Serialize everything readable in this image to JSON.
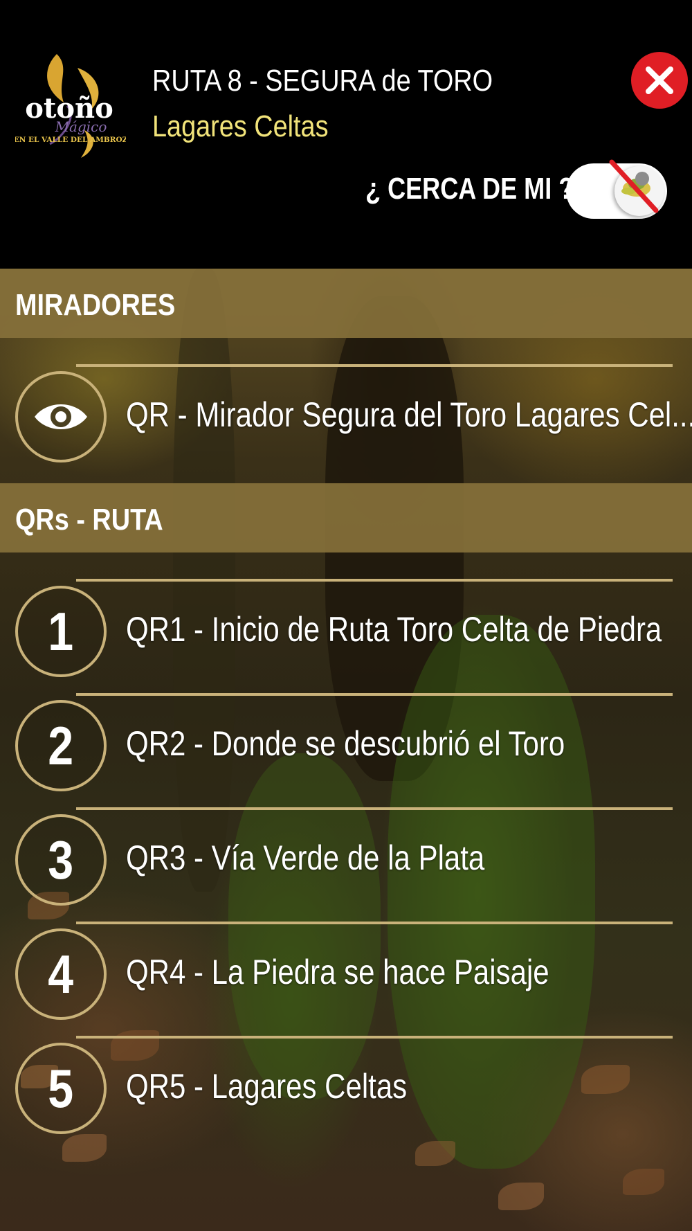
{
  "header": {
    "logo": {
      "word": "otoño",
      "script": "Mágico",
      "tagline": "EN EL VALLE DEL AMBROZ"
    },
    "title": "RUTA 8 - SEGURA de TORO",
    "subtitle": "Lagares Celtas",
    "close_icon": "close-icon",
    "near_label": "¿ CERCA DE MI ?",
    "near_toggle": {
      "enabled": false,
      "icon": "location-disabled-icon"
    }
  },
  "sections": [
    {
      "title": "MIRADORES",
      "items": [
        {
          "icon": "eye-icon",
          "label": "QR - Mirador Segura del Toro Lagares Cel..."
        }
      ]
    },
    {
      "title": "QRs - RUTA",
      "items": [
        {
          "number": "1",
          "label": "QR1 - Inicio de Ruta Toro Celta de Piedra"
        },
        {
          "number": "2",
          "label": "QR2 - Donde se descubrió el Toro"
        },
        {
          "number": "3",
          "label": "QR3 - Vía Verde de la Plata"
        },
        {
          "number": "4",
          "label": "QR4 - La Piedra se hace Paisaje"
        },
        {
          "number": "5",
          "label": "QR5 - Lagares Celtas"
        }
      ]
    }
  ],
  "colors": {
    "accent_gold": "#c9b27a",
    "section_band": "#85703a",
    "subtitle_yellow": "#f1e37a",
    "close_red": "#e01e25"
  }
}
